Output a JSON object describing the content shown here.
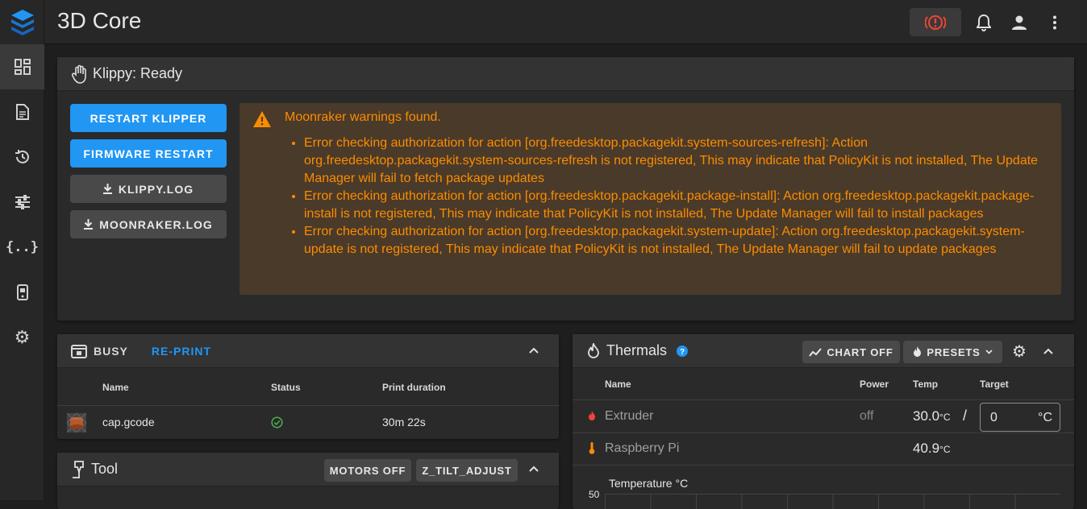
{
  "app": {
    "title": "3D Core"
  },
  "nav": [
    "dashboard-icon",
    "files-icon",
    "history-icon",
    "tune-icon",
    "macros-icon",
    "machine-icon",
    "settings-icon"
  ],
  "klippy": {
    "title": "Klippy: Ready",
    "buttons": {
      "restart": "RESTART KLIPPER",
      "firmware": "FIRMWARE RESTART",
      "klippy_log": "KLIPPY.LOG",
      "moonraker_log": "MOONRAKER.LOG"
    },
    "warning_title": "Moonraker warnings found.",
    "warnings": [
      "Error checking authorization for action [org.freedesktop.packagekit.system-sources-refresh]: Action org.freedesktop.packagekit.system-sources-refresh is not registered, This may indicate that PolicyKit is not installed, The Update Manager will fail to fetch package updates",
      "Error checking authorization for action [org.freedesktop.packagekit.package-install]: Action org.freedesktop.packagekit.package-install is not registered, This may indicate that PolicyKit is not installed, The Update Manager will fail to install packages",
      "Error checking authorization for action [org.freedesktop.packagekit.system-update]: Action org.freedesktop.packagekit.system-update is not registered, This may indicate that PolicyKit is not installed, The Update Manager will fail to update packages"
    ]
  },
  "job": {
    "status_label": "BUSY",
    "reprint_label": "RE-PRINT",
    "headers": {
      "name": "Name",
      "status": "Status",
      "duration": "Print duration"
    },
    "row": {
      "name": "cap.gcode",
      "duration": "30m 22s"
    }
  },
  "tool": {
    "title": "Tool",
    "motors_off": "MOTORS OFF",
    "z_tilt": "Z_TILT_ADJUST"
  },
  "thermals": {
    "title": "Thermals",
    "chart_off": "CHART OFF",
    "presets": "PRESETS",
    "headers": {
      "name": "Name",
      "power": "Power",
      "temp": "Temp",
      "target": "Target"
    },
    "extruder": {
      "name": "Extruder",
      "power": "off",
      "temp": "30.0",
      "unit": "°C",
      "target": "0",
      "target_unit": "°C"
    },
    "pi": {
      "name": "Raspberry Pi",
      "temp": "40.9",
      "unit": "°C"
    },
    "chart_label": "Temperature °C",
    "chart_top_tick": "50"
  },
  "colors": {
    "accent": "#2196f3",
    "warning": "#fb8c00",
    "estop": "#f44336",
    "success": "#4caf50"
  }
}
